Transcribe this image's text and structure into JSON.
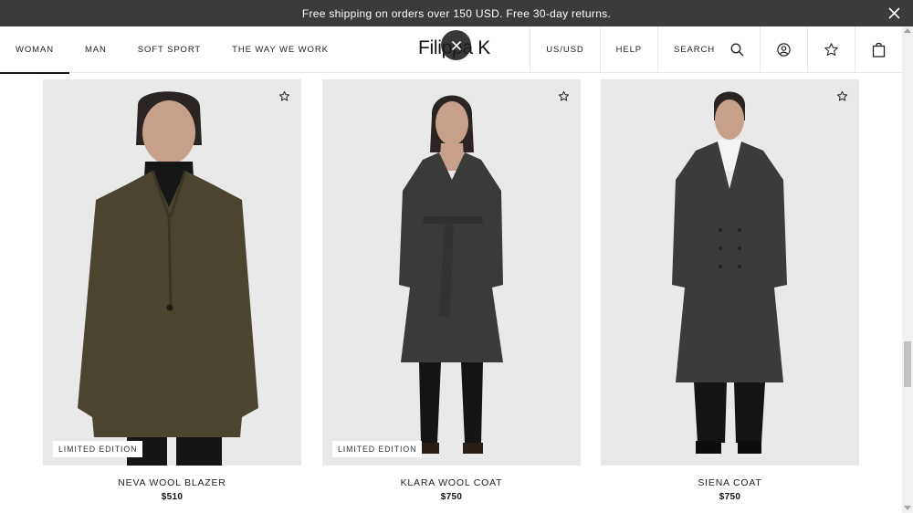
{
  "banner": {
    "text": "Free shipping on orders over 150 USD. Free 30-day returns."
  },
  "nav": {
    "items": [
      {
        "label": "WOMAN",
        "active": true
      },
      {
        "label": "MAN"
      },
      {
        "label": "SOFT SPORT"
      },
      {
        "label": "THE WAY WE WORK"
      }
    ],
    "logo": "Filippa K",
    "region": "US/USD",
    "help": "HELP",
    "search": "SEARCH"
  },
  "products": [
    {
      "name": "NEVA WOOL BLAZER",
      "price": "$510",
      "badge": "LIMITED EDITION"
    },
    {
      "name": "KLARA WOOL COAT",
      "price": "$750",
      "badge": "LIMITED EDITION"
    },
    {
      "name": "SIENA COAT",
      "price": "$750"
    }
  ],
  "colors": {
    "banner_bg": "#3b3b3b",
    "image_bg": "#e9e9e9",
    "blazer": "#4a4430",
    "coat": "#3a3a3a"
  }
}
